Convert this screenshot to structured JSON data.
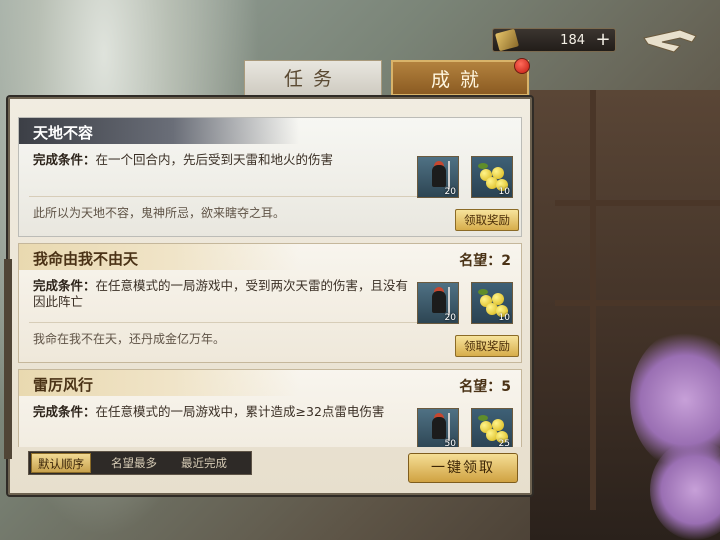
{
  "currency": {
    "value": "184",
    "plus": "+",
    "icon": "scroll-token-icon"
  },
  "tabs": [
    {
      "label": "任务",
      "active": false
    },
    {
      "label": "成就",
      "active": true
    }
  ],
  "achievements": [
    {
      "title": "天地不容",
      "fame": "",
      "condition_label": "完成条件：",
      "condition": "在一个回合内，先后受到天雷和地火的伤害",
      "flavor": "此所以为天地不容，鬼神所忌，欲来瞎夺之耳。",
      "rewards": [
        {
          "icon": "general-card-icon",
          "count": "20"
        },
        {
          "icon": "fruit-icon",
          "count": "10"
        }
      ],
      "claim_label": "领取奖励"
    },
    {
      "title": "我命由我不由天",
      "fame": "名望：2",
      "condition_label": "完成条件：",
      "condition": "在任意模式的一局游戏中，受到两次天雷的伤害，且没有因此阵亡",
      "flavor": "我命在我不在天，还丹成金亿万年。",
      "rewards": [
        {
          "icon": "general-card-icon",
          "count": "20"
        },
        {
          "icon": "fruit-icon",
          "count": "10"
        }
      ],
      "claim_label": "领取奖励"
    },
    {
      "title": "雷厉风行",
      "fame": "名望：5",
      "condition_label": "完成条件：",
      "condition": "在任意模式的一局游戏中，累计造成≥32点雷电伤害",
      "flavor": "",
      "rewards": [
        {
          "icon": "general-card-icon",
          "count": "50"
        },
        {
          "icon": "fruit-icon",
          "count": "25"
        }
      ],
      "claim_label": ""
    }
  ],
  "sort": {
    "default_label": "默认顺序",
    "option_fame": "名望最多",
    "option_recent": "最近完成"
  },
  "claim_all_label": "一键领取",
  "colors": {
    "accent_gold": "#d7ad4b",
    "notification_red": "#c21a10"
  }
}
